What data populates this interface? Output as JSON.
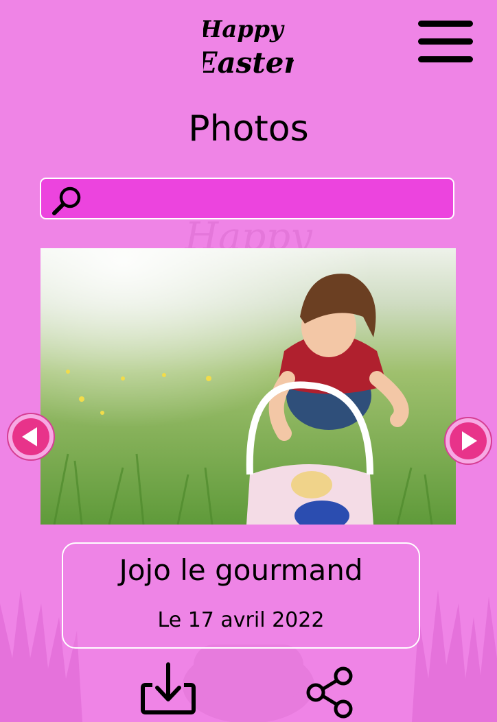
{
  "logo": {
    "line1": "Happy",
    "line2": "Easter"
  },
  "header": {
    "menu_icon": "hamburger-menu-icon"
  },
  "page": {
    "title": "Photos"
  },
  "search": {
    "icon": "search-icon",
    "placeholder": "",
    "value": ""
  },
  "gallery": {
    "photo_alt": "Child picking up an Easter egg from a basket in the grass",
    "prev_icon": "chevron-left-icon",
    "next_icon": "chevron-right-icon"
  },
  "caption": {
    "title": "Jojo le gourmand",
    "date": "Le 17 avril 2022"
  },
  "actions": {
    "download_icon": "download-icon",
    "share_icon": "share-icon"
  },
  "colors": {
    "background": "#ef84e6",
    "search_bg": "#ec44de",
    "nav_button": "#e8338a",
    "text": "#000000"
  }
}
